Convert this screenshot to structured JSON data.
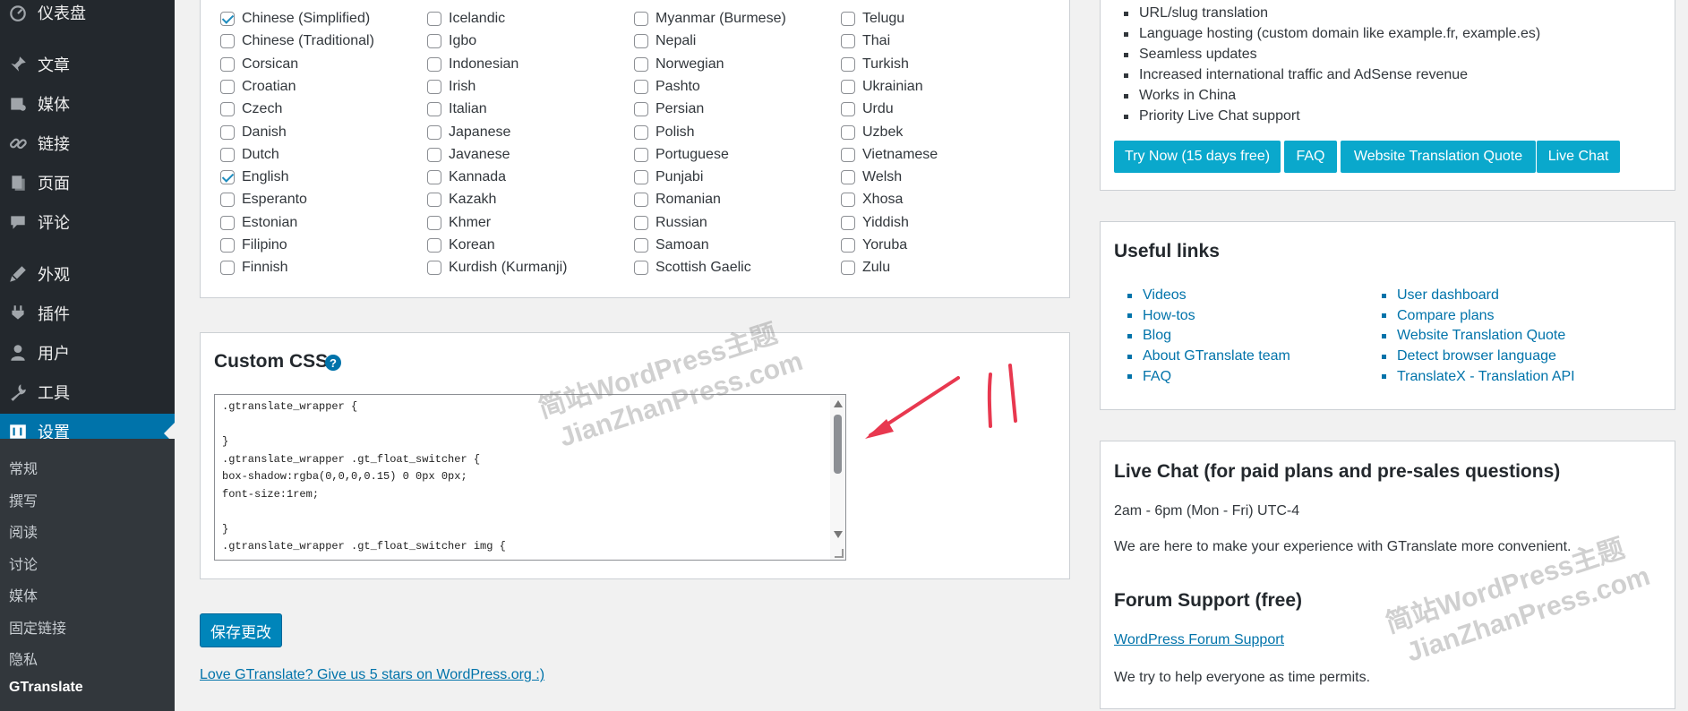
{
  "sidebar": {
    "menu": [
      {
        "label": "仪表盘",
        "icon": "dashboard-icon"
      },
      {
        "label": "文章",
        "icon": "pin-icon"
      },
      {
        "label": "媒体",
        "icon": "media-icon"
      },
      {
        "label": "链接",
        "icon": "link-icon"
      },
      {
        "label": "页面",
        "icon": "page-icon"
      },
      {
        "label": "评论",
        "icon": "comment-icon"
      },
      {
        "label": "外观",
        "icon": "brush-icon"
      },
      {
        "label": "插件",
        "icon": "plugin-icon"
      },
      {
        "label": "用户",
        "icon": "user-icon"
      },
      {
        "label": "工具",
        "icon": "wrench-icon"
      },
      {
        "label": "设置",
        "icon": "settings-icon"
      }
    ],
    "submenu": [
      "常规",
      "撰写",
      "阅读",
      "讨论",
      "媒体",
      "固定链接",
      "隐私",
      "GTranslate"
    ],
    "current_submenu": "GTranslate"
  },
  "languages": {
    "columns": [
      [
        {
          "name": "Chinese (Simplified)",
          "checked": true
        },
        {
          "name": "Chinese (Traditional)",
          "checked": false
        },
        {
          "name": "Corsican",
          "checked": false
        },
        {
          "name": "Croatian",
          "checked": false
        },
        {
          "name": "Czech",
          "checked": false
        },
        {
          "name": "Danish",
          "checked": false
        },
        {
          "name": "Dutch",
          "checked": false
        },
        {
          "name": "English",
          "checked": true
        },
        {
          "name": "Esperanto",
          "checked": false
        },
        {
          "name": "Estonian",
          "checked": false
        },
        {
          "name": "Filipino",
          "checked": false
        },
        {
          "name": "Finnish",
          "checked": false
        }
      ],
      [
        {
          "name": "Icelandic",
          "checked": false
        },
        {
          "name": "Igbo",
          "checked": false
        },
        {
          "name": "Indonesian",
          "checked": false
        },
        {
          "name": "Irish",
          "checked": false
        },
        {
          "name": "Italian",
          "checked": false
        },
        {
          "name": "Japanese",
          "checked": false
        },
        {
          "name": "Javanese",
          "checked": false
        },
        {
          "name": "Kannada",
          "checked": false
        },
        {
          "name": "Kazakh",
          "checked": false
        },
        {
          "name": "Khmer",
          "checked": false
        },
        {
          "name": "Korean",
          "checked": false
        },
        {
          "name": "Kurdish (Kurmanji)",
          "checked": false
        }
      ],
      [
        {
          "name": "Myanmar (Burmese)",
          "checked": false
        },
        {
          "name": "Nepali",
          "checked": false
        },
        {
          "name": "Norwegian",
          "checked": false
        },
        {
          "name": "Pashto",
          "checked": false
        },
        {
          "name": "Persian",
          "checked": false
        },
        {
          "name": "Polish",
          "checked": false
        },
        {
          "name": "Portuguese",
          "checked": false
        },
        {
          "name": "Punjabi",
          "checked": false
        },
        {
          "name": "Romanian",
          "checked": false
        },
        {
          "name": "Russian",
          "checked": false
        },
        {
          "name": "Samoan",
          "checked": false
        },
        {
          "name": "Scottish Gaelic",
          "checked": false
        }
      ],
      [
        {
          "name": "Telugu",
          "checked": false
        },
        {
          "name": "Thai",
          "checked": false
        },
        {
          "name": "Turkish",
          "checked": false
        },
        {
          "name": "Ukrainian",
          "checked": false
        },
        {
          "name": "Urdu",
          "checked": false
        },
        {
          "name": "Uzbek",
          "checked": false
        },
        {
          "name": "Vietnamese",
          "checked": false
        },
        {
          "name": "Welsh",
          "checked": false
        },
        {
          "name": "Xhosa",
          "checked": false
        },
        {
          "name": "Yiddish",
          "checked": false
        },
        {
          "name": "Yoruba",
          "checked": false
        },
        {
          "name": "Zulu",
          "checked": false
        }
      ]
    ]
  },
  "custom_css": {
    "title": "Custom CSS",
    "help_glyph": "?",
    "lines": [
      ".gtranslate_wrapper {",
      "",
      "}",
      ".gtranslate_wrapper .gt_float_switcher {",
      "box-shadow:rgba(0,0,0,0.15) 0 0px 0px;",
      "font-size:1rem;",
      "",
      "}",
      ".gtranslate_wrapper .gt_float_switcher img {"
    ]
  },
  "save_button": "保存更改",
  "review_link": "Love GTranslate? Give us 5 stars on WordPress.org :)",
  "pro_box": {
    "features": [
      "URL/slug translation",
      "Language hosting (custom domain like example.fr, example.es)",
      "Seamless updates",
      "Increased international traffic and AdSense revenue",
      "Works in China",
      "Priority Live Chat support"
    ],
    "buttons": [
      "Try Now (15 days free)",
      "FAQ",
      "Website Translation Quote",
      "Live Chat"
    ]
  },
  "useful_links": {
    "title": "Useful links",
    "left": [
      "Videos",
      "How-tos",
      "Blog",
      "About GTranslate team",
      "FAQ"
    ],
    "right": [
      "User dashboard",
      "Compare plans",
      "Website Translation Quote",
      "Detect browser language",
      "TranslateX - Translation API"
    ]
  },
  "live_chat": {
    "title": "Live Chat (for paid plans and pre-sales questions)",
    "hours": "2am - 6pm (Mon - Fri) UTC-4",
    "description": "We are here to make your experience with GTranslate more convenient."
  },
  "forum_support": {
    "title": "Forum Support (free)",
    "link": "WordPress Forum Support",
    "description": "We try to help everyone as time permits."
  },
  "watermark": {
    "line1": "简站WordPress主题",
    "line2": "JianZhanPress.com"
  },
  "colors": {
    "primary": "#0085ba",
    "action": "#0aa8cc",
    "annotation": "#e8384f"
  }
}
